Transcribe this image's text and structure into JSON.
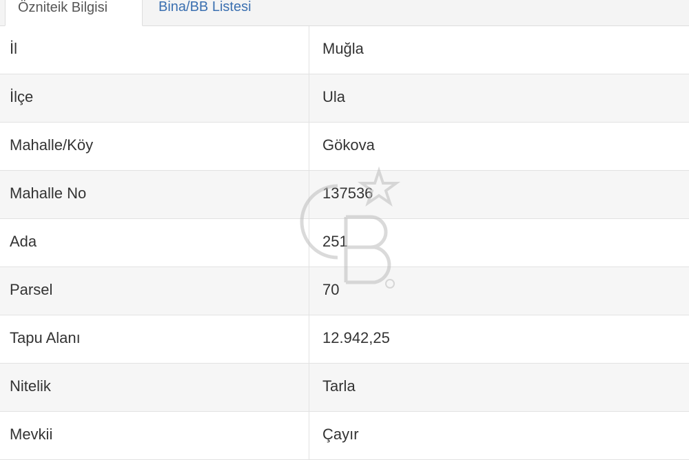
{
  "tabs": [
    {
      "label": "Özniteik Bilgisi",
      "active": true
    },
    {
      "label": "Bina/BB Listesi",
      "active": false
    }
  ],
  "rows": [
    {
      "label": "İl",
      "value": "Muğla"
    },
    {
      "label": "İlçe",
      "value": "Ula"
    },
    {
      "label": "Mahalle/Köy",
      "value": "Gökova"
    },
    {
      "label": "Mahalle No",
      "value": "137536"
    },
    {
      "label": "Ada",
      "value": "251"
    },
    {
      "label": "Parsel",
      "value": "70"
    },
    {
      "label": "Tapu Alanı",
      "value": "12.942,25"
    },
    {
      "label": "Nitelik",
      "value": "Tarla"
    },
    {
      "label": "Mevkii",
      "value": "Çayır"
    }
  ],
  "watermark": {
    "icon": "cb-logo-watermark",
    "color": "#bbbbbb"
  }
}
